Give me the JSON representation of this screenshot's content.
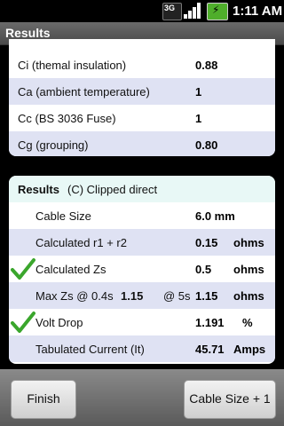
{
  "status_bar": {
    "network": "3G",
    "time": "1:11 AM"
  },
  "title": "Results",
  "factors": [
    {
      "label": "Ci  (themal insulation)",
      "value": "0.88"
    },
    {
      "label": "Ca  (ambient temperature)",
      "value": "1"
    },
    {
      "label": "Cc  (BS 3036 Fuse)",
      "value": "1"
    },
    {
      "label": "Cg  (grouping)",
      "value": "0.80"
    }
  ],
  "results": {
    "heading": "Results",
    "method": "(C) Clipped direct",
    "cable_size": {
      "label": "Cable Size",
      "value": "6.0 mm"
    },
    "r1r2": {
      "label": "Calculated r1 + r2",
      "value": "0.15",
      "unit": "ohms"
    },
    "zs": {
      "label": "Calculated Zs",
      "value": "0.5",
      "unit": "ohms"
    },
    "max_zs": {
      "label": "Max Zs  @ 0.4s",
      "value_04": "1.15",
      "label_5s": "@ 5s",
      "value_5": "1.15",
      "unit": "ohms"
    },
    "volt_drop": {
      "label": "Volt Drop",
      "value": "1.191",
      "unit": "%"
    },
    "current": {
      "label": "Tabulated Current (It)",
      "value": "45.71",
      "unit": "Amps"
    }
  },
  "buttons": {
    "finish": "Finish",
    "cable_size_plus": "Cable Size + 1"
  },
  "colors": {
    "check": "#3aa62c",
    "alt_row": "#dfe2f3",
    "header_row": "#e8f8f6"
  }
}
